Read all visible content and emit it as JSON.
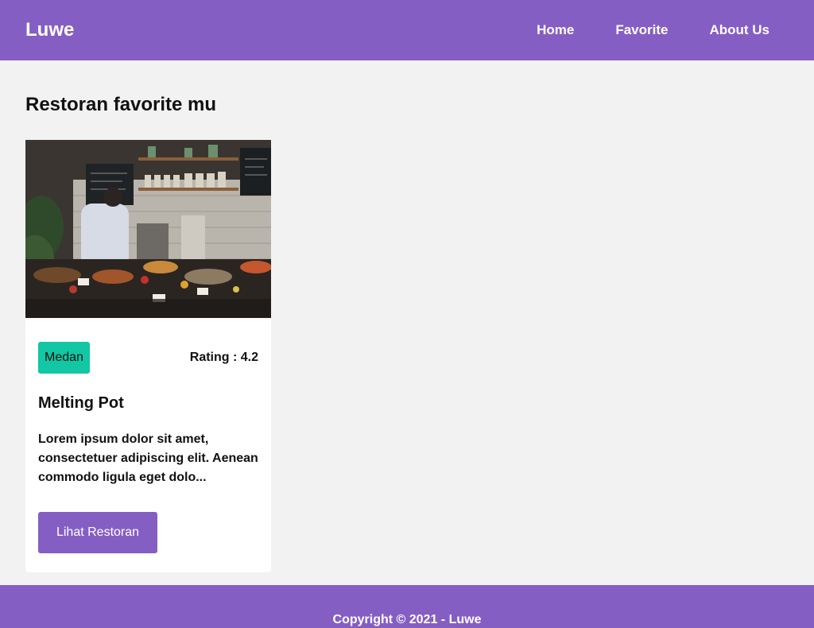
{
  "brand": "Luwe",
  "nav": {
    "items": [
      {
        "label": "Home"
      },
      {
        "label": "Favorite"
      },
      {
        "label": "About Us"
      }
    ]
  },
  "page": {
    "title": "Restoran favorite mu"
  },
  "restaurant": {
    "city": "Medan",
    "rating": "Rating : 4.2",
    "name": "Melting Pot",
    "description": "Lorem ipsum dolor sit amet, consectetuer adipiscing elit. Aenean commodo ligula eget dolo...",
    "button_label": "Lihat Restoran",
    "image_icon": "restaurant-photo"
  },
  "footer": {
    "text": "Copyright © 2021 - Luwe"
  },
  "colors": {
    "primary": "#855ec4",
    "badge": "#11c7a4",
    "background": "#f2f2f2"
  }
}
